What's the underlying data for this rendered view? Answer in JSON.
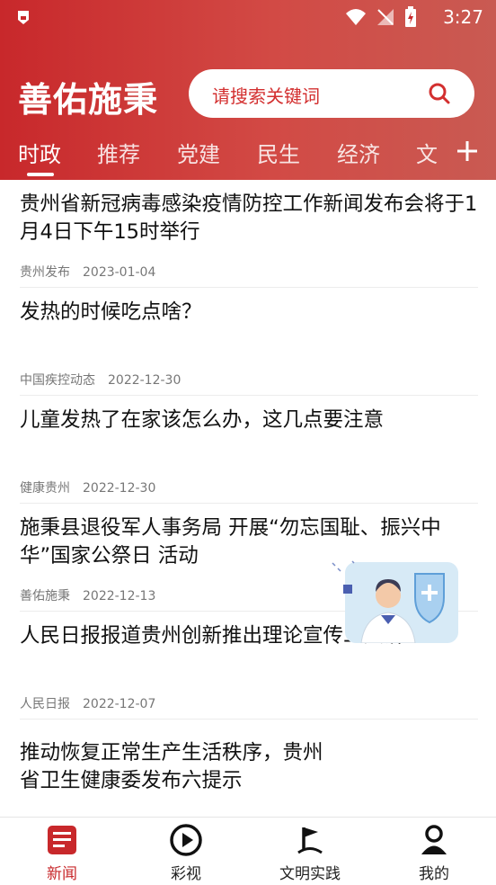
{
  "status_bar": {
    "time": "3:27"
  },
  "header": {
    "logo": "善佑施秉",
    "search_placeholder": "请搜索关键词",
    "tabs": [
      "时政",
      "推荐",
      "党建",
      "民生",
      "经济",
      "文"
    ],
    "active_tab": "时政"
  },
  "news": [
    {
      "title": "贵州省新冠病毒感染疫情防控工作新闻发布会将于1月4日下午15时举行",
      "source": "贵州发布",
      "date": "2023-01-04"
    },
    {
      "title": "发热的时候吃点啥？",
      "source": "中国疾控动态",
      "date": "2022-12-30"
    },
    {
      "title": "儿童发热了在家该怎么办，这几点要注意",
      "source": "健康贵州",
      "date": "2022-12-30"
    },
    {
      "title": "施秉县退役军人事务局 开展“勿忘国耻、振兴中华”国家公祭日 活动",
      "source": "善佑施秉",
      "date": "2022-12-13"
    },
    {
      "title": "人民日报报道贵州创新推出理论宣传二人讲",
      "source": "人民日报",
      "date": "2022-12-07"
    },
    {
      "title": "推动恢复正常生产生活秩序，贵州省卫生健康委发布六提示",
      "source": "",
      "date": ""
    }
  ],
  "bottom_nav": [
    {
      "label": "新闻",
      "icon": "news-icon",
      "active": true
    },
    {
      "label": "彩视",
      "icon": "play-icon",
      "active": false
    },
    {
      "label": "文明实践",
      "icon": "flag-icon",
      "active": false
    },
    {
      "label": "我的",
      "icon": "user-icon",
      "active": false
    }
  ],
  "colors": {
    "brand": "#c8282b",
    "text": "#111111",
    "meta": "#777777"
  }
}
